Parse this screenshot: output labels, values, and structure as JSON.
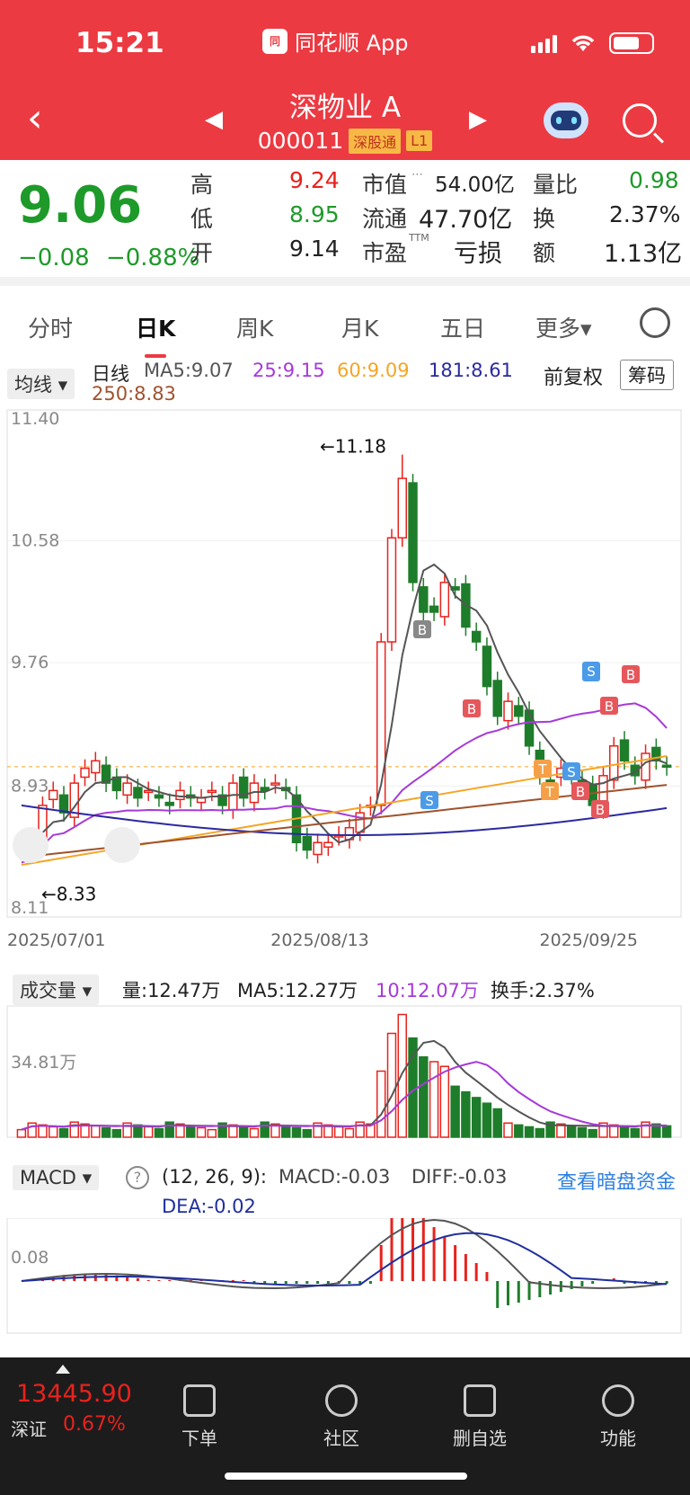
{
  "status": {
    "time": "15:21",
    "app": "同花顺 App"
  },
  "header": {
    "name": "深物业 A",
    "code": "000011",
    "tag1": "深股通",
    "tag2": "L1"
  },
  "quote": {
    "price": "9.06",
    "change": "−0.08",
    "pct": "−0.88%",
    "high_label": "高",
    "high": "9.24",
    "low_label": "低",
    "low": "8.95",
    "open_label": "开",
    "open": "9.14",
    "mcap_label": "市值",
    "mcap": "54.00亿",
    "float_label": "流通",
    "float": "47.70亿",
    "pe_label": "市盈",
    "pe_sup": "TTM",
    "pe": "亏损",
    "vr_label": "量比",
    "vr": "0.98",
    "turn_label": "换",
    "turn": "2.37%",
    "amt_label": "额",
    "amt": "1.13亿"
  },
  "tabs": [
    "分时",
    "日K",
    "周K",
    "月K",
    "五日",
    "更多▾"
  ],
  "ma": {
    "chip": "均线 ▾",
    "type": "日线",
    "ma5": "MA5:9.07",
    "ma25": "25:9.15",
    "ma60": "60:9.09",
    "ma181": "181:8.61",
    "ma250": "250:8.83",
    "adjust": "前复权",
    "chip_code": "筹码"
  },
  "colors": {
    "up": "#e8221d",
    "down": "#1e7d2a",
    "ma5": "#555555",
    "ma25": "#a63ad8",
    "ma60": "#f5a524",
    "ma181": "#2a2aa0",
    "ma250": "#a0522d"
  },
  "kline": {
    "y_ticks": [
      "11.40",
      "10.58",
      "9.76",
      "8.93",
      "8.11"
    ],
    "x_labels": [
      "2025/07/01",
      "2025/08/13",
      "2025/09/25"
    ],
    "high_note": "←11.18",
    "low_note": "←8.33",
    "markers": [
      "B",
      "B",
      "S",
      "S",
      "T",
      "T",
      "S",
      "B",
      "B",
      "B",
      "S",
      "B"
    ]
  },
  "volume": {
    "chip": "成交量 ▾",
    "vol": "量:12.47万",
    "ma5": "MA5:12.27万",
    "ma10": "10:12.07万",
    "turn": "换手:2.37%",
    "y_tick": "34.81万"
  },
  "macd": {
    "chip": "MACD ▾",
    "help": "?",
    "params": "(12, 26, 9):",
    "macd": "MACD:-0.03",
    "diff": "DIFF:-0.03",
    "dea": "DEA:-0.02",
    "link": "查看暗盘资金",
    "y_tick": "0.08"
  },
  "bottom": {
    "index_value": "13445.90",
    "index_name": "深证",
    "index_pct": "0.67%",
    "nav": [
      "下单",
      "社区",
      "删自选",
      "功能"
    ]
  },
  "chart_data": {
    "type": "candlestick",
    "categories_range": [
      "2025/07/01",
      "2025/09/25"
    ],
    "ylim": [
      8.11,
      11.4
    ],
    "x_count": 62,
    "close": [
      8.5,
      8.55,
      8.8,
      8.9,
      8.75,
      8.95,
      9.05,
      9.1,
      8.95,
      8.9,
      8.95,
      8.85,
      8.9,
      8.85,
      8.8,
      8.9,
      8.85,
      8.85,
      8.9,
      8.8,
      8.95,
      8.85,
      8.95,
      8.9,
      8.95,
      8.9,
      8.55,
      8.5,
      8.55,
      8.55,
      8.6,
      8.65,
      8.75,
      8.8,
      9.9,
      10.6,
      11.0,
      10.3,
      10.1,
      10.1,
      10.3,
      10.25,
      10.0,
      9.9,
      9.6,
      9.4,
      9.5,
      9.4,
      9.2,
      9.0,
      8.95,
      9.05,
      9.0,
      8.9,
      8.8,
      9.0,
      9.2,
      9.1,
      9.0,
      9.15,
      9.1,
      9.06
    ],
    "volume_peak": 34.81
  }
}
